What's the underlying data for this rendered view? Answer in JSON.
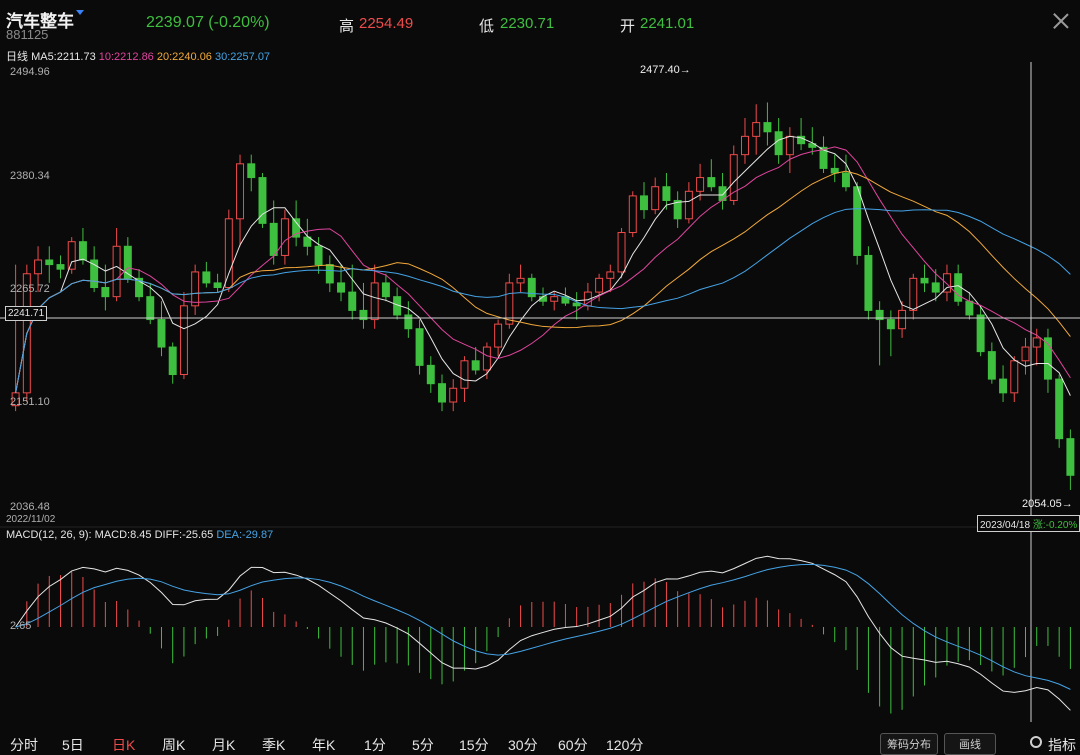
{
  "header": {
    "title": "汽车整车",
    "code": "881125",
    "price": "2239.07 (-0.20%)",
    "high_label": "高",
    "high_value": "2254.49",
    "low_label": "低",
    "low_value": "2230.71",
    "open_label": "开",
    "open_value": "2241.01",
    "colors": {
      "up": "#ef4b4b",
      "down": "#3fbf3f"
    }
  },
  "ma_row": {
    "prefix": "日线",
    "ma5": "MA5:2211.73",
    "ma10": "10:2212.86",
    "ma20": "20:2240.06",
    "ma30": "30:2257.07"
  },
  "price_axis": [
    "2494.96",
    "2380.34",
    "2265.72",
    "2151.10",
    "2036.48"
  ],
  "cursor_price": "2241.71",
  "start_date": "2022/11/02",
  "cursor_date": "2023/04/18",
  "cursor_change": "涨:-0.20%",
  "high_annotation": "2477.40→",
  "low_annotation": "2054.05→",
  "macd": {
    "label": "MACD(12, 26, 9):",
    "macd": "MACD:8.45",
    "diff": "DIFF:-25.65",
    "dea": "DEA:-29.87",
    "axis": "2.65"
  },
  "tabs": [
    "分时",
    "5日",
    "日K",
    "周K",
    "月K",
    "季K",
    "年K",
    "1分",
    "5分",
    "15分",
    "30分",
    "60分",
    "120分"
  ],
  "active_tab": "日K",
  "buttons": {
    "chips": "筹码分布",
    "draw": "画线",
    "indicator": "指标"
  },
  "icons": {
    "close": "close-icon",
    "dropdown": "chevron-down-icon",
    "settings": "gear-icon"
  },
  "chart_data": {
    "type": "candlestick",
    "title": "汽车整车",
    "ylim": [
      2036.48,
      2494.96
    ],
    "x_range": [
      "2022/11/02",
      "2023/04/18"
    ],
    "ohlc": [
      [
        2146,
        2300,
        2140,
        2160
      ],
      [
        2160,
        2300,
        2150,
        2290
      ],
      [
        2290,
        2320,
        2270,
        2305
      ],
      [
        2305,
        2320,
        2280,
        2300
      ],
      [
        2300,
        2310,
        2285,
        2295
      ],
      [
        2295,
        2330,
        2290,
        2325
      ],
      [
        2325,
        2340,
        2300,
        2305
      ],
      [
        2305,
        2320,
        2270,
        2275
      ],
      [
        2275,
        2300,
        2250,
        2265
      ],
      [
        2265,
        2340,
        2260,
        2320
      ],
      [
        2320,
        2330,
        2280,
        2285
      ],
      [
        2285,
        2295,
        2260,
        2265
      ],
      [
        2265,
        2280,
        2235,
        2240
      ],
      [
        2240,
        2260,
        2200,
        2210
      ],
      [
        2210,
        2215,
        2170,
        2180
      ],
      [
        2180,
        2270,
        2175,
        2255
      ],
      [
        2255,
        2300,
        2245,
        2292
      ],
      [
        2292,
        2303,
        2275,
        2280
      ],
      [
        2280,
        2290,
        2270,
        2275
      ],
      [
        2275,
        2360,
        2270,
        2350
      ],
      [
        2350,
        2420,
        2320,
        2410
      ],
      [
        2410,
        2420,
        2380,
        2395
      ],
      [
        2395,
        2400,
        2340,
        2345
      ],
      [
        2345,
        2370,
        2300,
        2310
      ],
      [
        2310,
        2360,
        2300,
        2350
      ],
      [
        2350,
        2370,
        2320,
        2330
      ],
      [
        2330,
        2350,
        2310,
        2320
      ],
      [
        2320,
        2330,
        2290,
        2300
      ],
      [
        2300,
        2310,
        2270,
        2280
      ],
      [
        2280,
        2300,
        2260,
        2270
      ],
      [
        2270,
        2300,
        2240,
        2250
      ],
      [
        2250,
        2280,
        2230,
        2240
      ],
      [
        2240,
        2300,
        2230,
        2280
      ],
      [
        2280,
        2290,
        2260,
        2265
      ],
      [
        2265,
        2275,
        2240,
        2245
      ],
      [
        2245,
        2260,
        2220,
        2230
      ],
      [
        2230,
        2240,
        2180,
        2190
      ],
      [
        2190,
        2200,
        2160,
        2170
      ],
      [
        2170,
        2180,
        2140,
        2150
      ],
      [
        2150,
        2175,
        2140,
        2165
      ],
      [
        2165,
        2200,
        2150,
        2195
      ],
      [
        2195,
        2210,
        2180,
        2185
      ],
      [
        2185,
        2215,
        2175,
        2210
      ],
      [
        2210,
        2240,
        2200,
        2235
      ],
      [
        2235,
        2290,
        2230,
        2280
      ],
      [
        2280,
        2300,
        2270,
        2285
      ],
      [
        2285,
        2290,
        2260,
        2265
      ],
      [
        2265,
        2275,
        2255,
        2260
      ],
      [
        2260,
        2270,
        2250,
        2265
      ],
      [
        2265,
        2275,
        2255,
        2258
      ],
      [
        2258,
        2270,
        2240,
        2255
      ],
      [
        2255,
        2280,
        2250,
        2270
      ],
      [
        2270,
        2290,
        2260,
        2285
      ],
      [
        2285,
        2300,
        2270,
        2292
      ],
      [
        2292,
        2340,
        2285,
        2335
      ],
      [
        2335,
        2380,
        2330,
        2375
      ],
      [
        2375,
        2390,
        2350,
        2360
      ],
      [
        2360,
        2395,
        2355,
        2385
      ],
      [
        2385,
        2400,
        2360,
        2370
      ],
      [
        2370,
        2380,
        2340,
        2350
      ],
      [
        2350,
        2390,
        2345,
        2380
      ],
      [
        2380,
        2410,
        2370,
        2395
      ],
      [
        2395,
        2415,
        2380,
        2385
      ],
      [
        2385,
        2400,
        2360,
        2370
      ],
      [
        2370,
        2430,
        2365,
        2420
      ],
      [
        2420,
        2460,
        2410,
        2440
      ],
      [
        2440,
        2475,
        2420,
        2455
      ],
      [
        2455,
        2477,
        2430,
        2445
      ],
      [
        2445,
        2460,
        2410,
        2420
      ],
      [
        2420,
        2450,
        2400,
        2440
      ],
      [
        2440,
        2460,
        2425,
        2432
      ],
      [
        2432,
        2450,
        2420,
        2428
      ],
      [
        2428,
        2440,
        2400,
        2405
      ],
      [
        2405,
        2420,
        2390,
        2400
      ],
      [
        2400,
        2420,
        2380,
        2385
      ],
      [
        2385,
        2390,
        2300,
        2310
      ],
      [
        2310,
        2320,
        2240,
        2250
      ],
      [
        2250,
        2260,
        2190,
        2240
      ],
      [
        2240,
        2250,
        2200,
        2230
      ],
      [
        2230,
        2260,
        2220,
        2250
      ],
      [
        2250,
        2290,
        2240,
        2285
      ],
      [
        2285,
        2300,
        2270,
        2280
      ],
      [
        2280,
        2295,
        2260,
        2270
      ],
      [
        2270,
        2300,
        2260,
        2290
      ],
      [
        2290,
        2300,
        2255,
        2260
      ],
      [
        2260,
        2270,
        2240,
        2245
      ],
      [
        2245,
        2255,
        2200,
        2205
      ],
      [
        2205,
        2215,
        2170,
        2175
      ],
      [
        2175,
        2190,
        2150,
        2160
      ],
      [
        2160,
        2200,
        2150,
        2195
      ],
      [
        2195,
        2220,
        2180,
        2210
      ],
      [
        2210,
        2230,
        2190,
        2220
      ],
      [
        2220,
        2230,
        2160,
        2175
      ],
      [
        2175,
        2180,
        2100,
        2110
      ],
      [
        2110,
        2120,
        2054,
        2070
      ]
    ]
  }
}
